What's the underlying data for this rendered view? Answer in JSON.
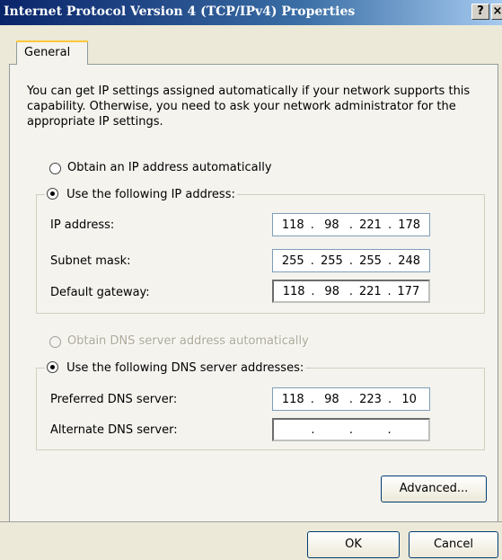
{
  "window": {
    "title": "Internet Protocol Version 4 (TCP/IPv4) Properties",
    "help_label": "?",
    "close_label": "×"
  },
  "tabs": [
    {
      "label": "General"
    }
  ],
  "general": {
    "description": "You can get IP settings assigned automatically if your network supports this capability. Otherwise, you need to ask your network administrator for the appropriate IP settings.",
    "ip_auto_label": "Obtain an IP address automatically",
    "ip_manual_label": "Use the following IP address:",
    "ip_mode": "manual",
    "ip_address_label": "IP address:",
    "ip_address": [
      "118",
      "98",
      "221",
      "178"
    ],
    "subnet_label": "Subnet mask:",
    "subnet_mask": [
      "255",
      "255",
      "255",
      "248"
    ],
    "gateway_label": "Default gateway:",
    "gateway": [
      "118",
      "98",
      "221",
      "177"
    ],
    "dns_auto_label": "Obtain DNS server address automatically",
    "dns_manual_label": "Use the following DNS server addresses:",
    "dns_mode": "manual",
    "preferred_dns_label": "Preferred DNS server:",
    "preferred_dns": [
      "118",
      "98",
      "223",
      "10"
    ],
    "alternate_dns_label": "Alternate DNS server:",
    "alternate_dns": [
      "",
      "",
      "",
      ""
    ],
    "advanced_label": "Advanced..."
  },
  "footer": {
    "ok_label": "OK",
    "cancel_label": "Cancel"
  },
  "colors": {
    "titlebar_start": "#0a246a",
    "titlebar_end": "#a6caf0",
    "dialog_bg": "#ece9d8",
    "panel_bg": "#f4f3ee",
    "tab_accent": "#ffc83c"
  }
}
